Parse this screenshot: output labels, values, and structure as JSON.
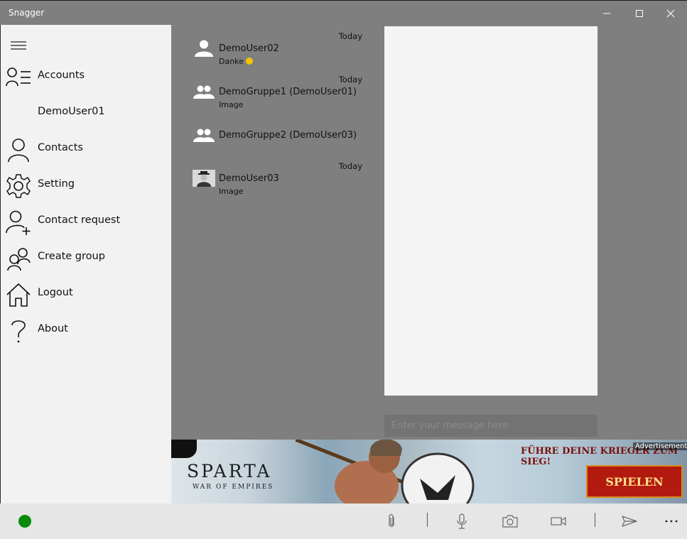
{
  "window": {
    "title": "Snagger"
  },
  "sidebar": {
    "items": [
      {
        "id": "accounts",
        "label": "Accounts",
        "icon": "accounts-icon"
      },
      {
        "id": "account-demouser01",
        "label": "DemoUser01",
        "icon": ""
      },
      {
        "id": "contacts",
        "label": "Contacts",
        "icon": "person-icon"
      },
      {
        "id": "setting",
        "label": "Setting",
        "icon": "gear-icon"
      },
      {
        "id": "contact-request",
        "label": "Contact request",
        "icon": "add-person-icon"
      },
      {
        "id": "create-group",
        "label": "Create group",
        "icon": "group-icon"
      },
      {
        "id": "logout",
        "label": "Logout",
        "icon": "home-icon"
      },
      {
        "id": "about",
        "label": "About",
        "icon": "question-icon"
      }
    ]
  },
  "chats": [
    {
      "name": "DemoUser02",
      "time": "Today",
      "preview": "Danke",
      "avatar": "person-avatar"
    },
    {
      "name": "DemoGruppe1 (DemoUser01)",
      "time": "Today",
      "preview": "Image",
      "avatar": "group-avatar"
    },
    {
      "name": "DemoGruppe2 (DemoUser03)",
      "time": "",
      "preview": "",
      "avatar": "group-avatar"
    },
    {
      "name": "DemoUser03",
      "time": "Today",
      "preview": "Image",
      "avatar": "photo-avatar"
    }
  ],
  "composer": {
    "placeholder": "Enter your message here"
  },
  "ad": {
    "title": "SPARTA",
    "subtitle": "WAR OF EMPIRES",
    "tagline": "FÜHRE DEINE KRIEGER ZUM SIEG!",
    "label": "Advertisement",
    "cta": "SPIELEN"
  },
  "status": {
    "color": "#0a8a0a"
  },
  "colors": {
    "background": "#7f7f7f",
    "sidebar": "#f2f2f2",
    "message_pane": "#f4f4f4",
    "bottom_bar": "#e6e6e6"
  }
}
